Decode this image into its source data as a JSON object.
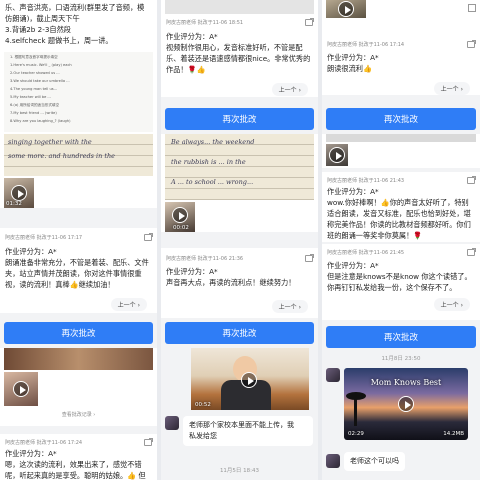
{
  "common": {
    "rebatch_label": "再次批改",
    "prev_label": "上一个"
  },
  "col1": {
    "top_text": [
      "乐、声音洪亮，口语流利(群里发了音频，模",
      "仿朗诵)，截止周天下午",
      "3.背诵2b 2-3自然段",
      "4.selfcheck 题做书上，周一讲。"
    ],
    "doc_lines": [
      "1. 根据句意及首字母提示填空",
      "1.Here's music. We'll _ (play) each",
      "2.Our teacher showed us ...",
      "3.We should take our umbrella ...",
      "4.The young man tell us...",
      "5.My teacher will be ...",
      "6.(a) 用所给词的适当形式填空",
      "7.My best friend ... (write)",
      "8.Why are you laughing_? (laugh)"
    ],
    "scrawl": [
      "singing together with the",
      "some more.    and hundreds in the"
    ],
    "video1_duration": "01:32",
    "card2_header": "阿皮古丽老师 批改于11-06 17:17",
    "card2_text": [
      "作业评分为：A*",
      "朗诵准备非常充分，不管是着装、配乐、文件",
      "夹，站立声情并茂朗读，你对这件事情很重",
      "视，读的流利！真棒👍继续加油！"
    ],
    "view_more": "查看批改记录 ›",
    "card3_header": "阿皮古丽老师 批改于11-06 17:24",
    "card3_text": [
      "作业评分为：A*",
      "嗯，这次读的流利，效果出来了，感觉不错",
      "呢，听起来真的是享受。聪明的姑娘。👍 但"
    ]
  },
  "col2": {
    "card1_header": "阿皮古丽老师 批改于11-06 18:51",
    "card1_text": [
      "作业评分为：A*",
      "视频制作很用心，发音标准好听，不管是配",
      "乐、着装还是语速感情都很nice。非常优秀的",
      "作品！🌹👍"
    ],
    "scrawl": [
      "Be always... the weekend",
      "the rubbish is ... in the",
      "A ... to school ... wrong..."
    ],
    "video1_duration": "00:02",
    "card2_header": "阿皮古丽老师 批改于11-06 21:36",
    "card2_text": [
      "作业评分为：A*",
      "声音再大点，再读的流利点！继续努力！"
    ],
    "video2_duration": "00:52",
    "chat_bubble": [
      "老师那个家校本里面不能上传，我",
      "私发给您"
    ],
    "chat_ts": "11月5日 18:43"
  },
  "col3": {
    "card1_header": "阿皮古丽老师 批改于11-06 17:14",
    "card1_text": [
      "作业评分为：A*",
      "朗读很流利👍"
    ],
    "card2_header": "阿皮古丽老师 批改于11-06 21:43",
    "card2_text": [
      "作业评分为：A*",
      "wow.你好棒啊！👍你的声音太好听了，特别",
      "适合朗读，发音又标准，配乐也恰到好处，堪",
      "称完美作品！你读的比教材音频都好听。你们",
      "班的朗诵一等奖非你莫属！🌹"
    ],
    "card3_header": "阿皮古丽老师 批改于11-06 21:45",
    "card3_text": [
      "作业评分为：A*",
      "但是注意是knows不是know 你这个读错了。",
      "你再钉钉私发给我一份，这个保存不了。"
    ],
    "chat_ts": "11月8日 23:50",
    "video_title": "Mom Knows Best",
    "video_duration": "02:29",
    "video_size": "14.2MB",
    "chat_bubble": "老师这个可以吗"
  }
}
